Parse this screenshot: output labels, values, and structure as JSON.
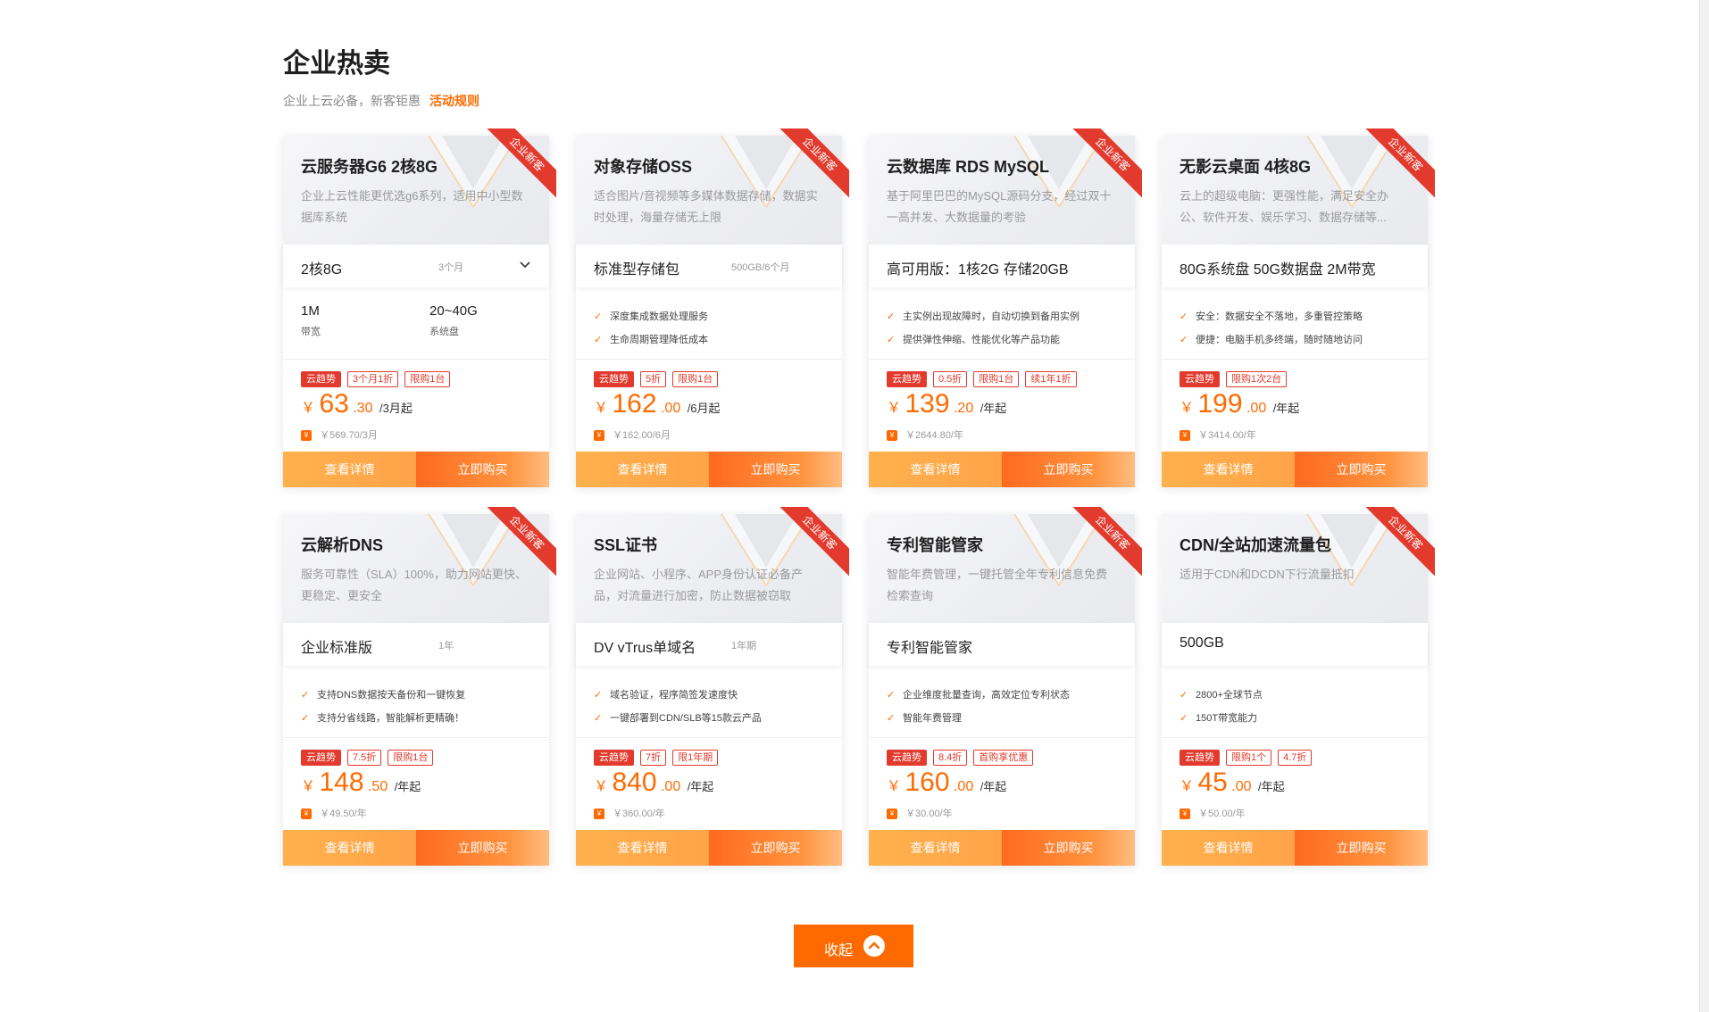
{
  "section": {
    "title": "企业热卖",
    "subtitle": "企业上云必备，新客钜惠",
    "rules_link": "活动规则"
  },
  "colors": {
    "accent": "#ff6a00",
    "ribbon": "#e33a2e",
    "detail_button": "#ffa94d",
    "buy_button": "#ff7a2e"
  },
  "cards": [
    {
      "title": "云服务器G6 2核8G",
      "desc": "企业上云性能更优选g6系列，适用中小型数据库系统",
      "ribbon": "企业新客",
      "spec": "2核8G",
      "spec_sub": "3个月",
      "metrics": [
        {
          "value": "1M",
          "label": "带宽"
        },
        {
          "value": "20~40G",
          "label": "系统盘"
        }
      ],
      "tags": [
        "云趋势",
        "3个月1折",
        "限购1台"
      ],
      "price_int": "63",
      "price_dec": ".30",
      "price_unit": "/3月起",
      "original": "￥569.70/3月"
    },
    {
      "title": "对象存储OSS",
      "desc": "适合图片/音视频等多媒体数据存储，数据实时处理，海量存储无上限",
      "ribbon": "企业新客",
      "spec": "标准型存储包",
      "spec_sub": "500GB/6个月",
      "features": [
        "深度集成数据处理服务",
        "生命周期管理降低成本"
      ],
      "tags": [
        "云趋势",
        "5折",
        "限购1台"
      ],
      "price_int": "162",
      "price_dec": ".00",
      "price_unit": "/6月起",
      "original": "￥162.00/6月"
    },
    {
      "title": "云数据库 RDS MySQL",
      "desc": "基于阿里巴巴的MySQL源码分支，经过双十一高并发、大数据量的考验",
      "ribbon": "企业新客",
      "spec": "高可用版：1核2G 存储20GB",
      "spec_sub": "",
      "features": [
        "主实例出现故障时，自动切换到备用实例",
        "提供弹性伸缩、性能优化等产品功能"
      ],
      "tags": [
        "云趋势",
        "0.5折",
        "限购1台",
        "续1年1折"
      ],
      "price_int": "139",
      "price_dec": ".20",
      "price_unit": "/年起",
      "original": "￥2644.80/年"
    },
    {
      "title": "无影云桌面 4核8G",
      "desc": "云上的超级电脑：更强性能，满足安全办公、软件开发、娱乐学习、数据存储等...",
      "ribbon": "企业新客",
      "spec": "80G系统盘 50G数据盘 2M带宽",
      "spec_sub": "",
      "features": [
        "安全：数据安全不落地，多重管控策略",
        "便捷：电脑手机多终端，随时随地访问"
      ],
      "tags": [
        "云趋势",
        "限购1次2台"
      ],
      "price_int": "199",
      "price_dec": ".00",
      "price_unit": "/年起",
      "original": "￥3414.00/年"
    },
    {
      "title": "云解析DNS",
      "desc": "服务可靠性（SLA）100%，助力网站更快、更稳定、更安全",
      "ribbon": "企业新客",
      "spec": "企业标准版",
      "spec_sub": "1年",
      "features": [
        "支持DNS数据按天备份和一键恢复",
        "支持分省线路，智能解析更精确！"
      ],
      "tags": [
        "云趋势",
        "7.5折",
        "限购1台"
      ],
      "price_int": "148",
      "price_dec": ".50",
      "price_unit": "/年起",
      "original": "￥49.50/年"
    },
    {
      "title": "SSL证书",
      "desc": "企业网站、小程序、APP身份认证必备产品，对流量进行加密，防止数据被窃取",
      "ribbon": "企业新客",
      "spec": "DV vTrus单域名",
      "spec_sub": "1年期",
      "features": [
        "域名验证，程序简签发速度快",
        "一键部署到CDN/SLB等15款云产品"
      ],
      "tags": [
        "云趋势",
        "7折",
        "限1年期"
      ],
      "price_int": "840",
      "price_dec": ".00",
      "price_unit": "/年起",
      "original": "￥360.00/年"
    },
    {
      "title": "专利智能管家",
      "desc": "智能年费管理，一键托管全年专利信息免费检索查询",
      "ribbon": "企业新客",
      "spec": "专利智能管家",
      "spec_sub": "",
      "features": [
        "企业维度批量查询，高效定位专利状态",
        "智能年费管理"
      ],
      "tags": [
        "云趋势",
        "8.4折",
        "首购享优惠"
      ],
      "price_int": "160",
      "price_dec": ".00",
      "price_unit": "/年起",
      "original": "￥30.00/年"
    },
    {
      "title": "CDN/全站加速流量包",
      "desc": "适用于CDN和DCDN下行流量抵扣",
      "ribbon": "企业新客",
      "spec": "500GB",
      "spec_sub": "",
      "features": [
        "2800+全球节点",
        "150T带宽能力"
      ],
      "tags": [
        "云趋势",
        "限购1个",
        "4.7折"
      ],
      "price_int": "45",
      "price_dec": ".00",
      "price_unit": "/年起",
      "original": "￥50.00/年"
    }
  ],
  "buttons": {
    "detail": "查看详情",
    "buy": "立即购买",
    "collapse": "收起"
  },
  "currency_symbol": "￥",
  "coupon_icon": "coupon-icon"
}
